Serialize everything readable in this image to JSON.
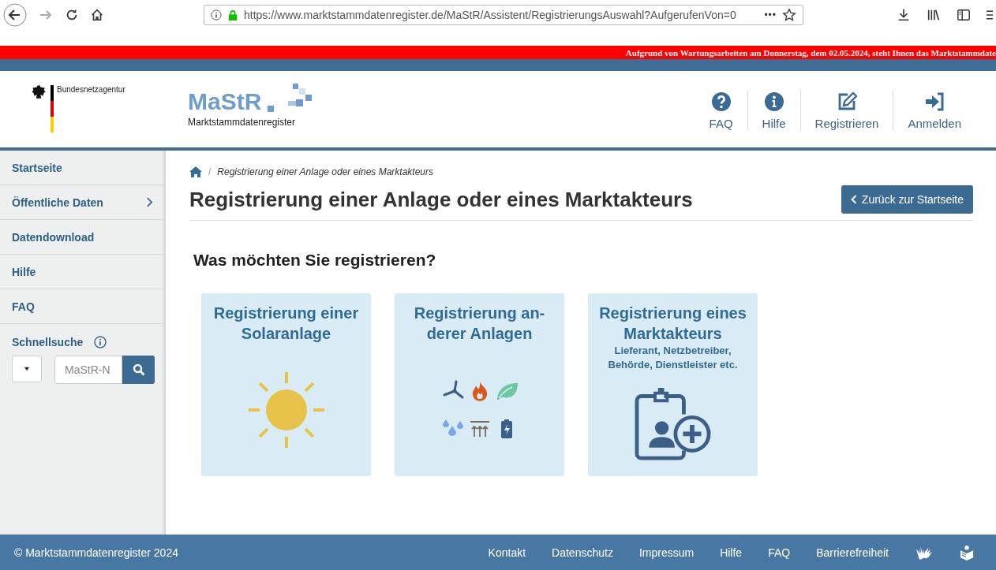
{
  "browser": {
    "url": "https://www.marktstammdatenregister.de/MaStR/Assistent/RegistrierungsAuswahl?AufgerufenVon=0",
    "menu_dots": "•••"
  },
  "banner": {
    "text": "Aufgrund von Wartungsarbeiten am Donnerstag, dem 02.05.2024, steht Ihnen das Marktstammdate"
  },
  "header": {
    "agency": "Bundesnetzagentur",
    "logo_text": "MaStR",
    "logo_subtitle": "Marktstammdatenregister",
    "nav": [
      {
        "label": "FAQ",
        "kind": "question"
      },
      {
        "label": "Hilfe",
        "kind": "info"
      },
      {
        "label": "Registrieren",
        "kind": "edit"
      },
      {
        "label": "Anmelden",
        "kind": "login"
      }
    ]
  },
  "sidebar": {
    "items": [
      {
        "label": "Startseite",
        "expandable": false
      },
      {
        "label": "Öffentliche Daten",
        "expandable": true
      },
      {
        "label": "Datendownload",
        "expandable": false
      },
      {
        "label": "Hilfe",
        "expandable": false
      },
      {
        "label": "FAQ",
        "expandable": false
      }
    ],
    "quick_search": {
      "label": "Schnellsuche",
      "placeholder": "MaStR-N"
    }
  },
  "breadcrumb_separator": "/",
  "breadcrumb": [
    "Registrierung einer Anlage oder eines Marktakteurs"
  ],
  "page_title": "Registrierung einer Anlage oder eines Marktakteurs",
  "back_button": "Zurück zur Startseite",
  "question": "Was möchten Sie registrieren?",
  "cards": [
    {
      "kind": "solar",
      "title": "Registrierung einer Solaranlage"
    },
    {
      "kind": "other",
      "title": "Registrierung an-derer Anlagen"
    },
    {
      "kind": "actor",
      "title": "Registrierung eines Marktakteurs",
      "subtitle": "Lieferant, Netzbetreiber, Behörde, Dienstleister etc."
    }
  ],
  "footer": {
    "copyright": "© Marktstammdatenregister 2024",
    "links": [
      "Kontakt",
      "Datenschutz",
      "Impressum",
      "Hilfe",
      "FAQ",
      "Barrierefreiheit"
    ]
  }
}
